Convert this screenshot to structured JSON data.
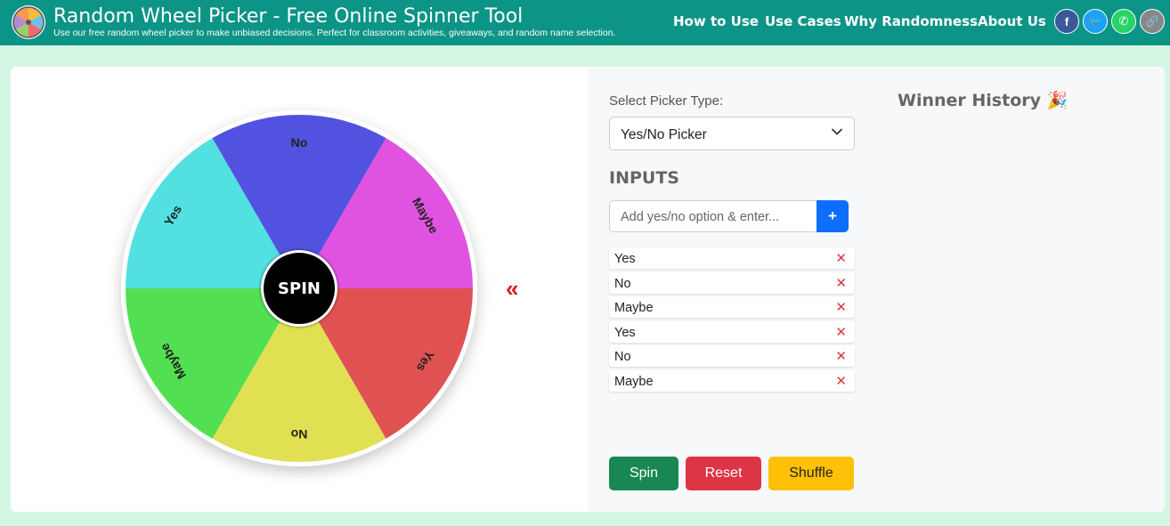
{
  "header": {
    "title": "Random Wheel Picker - Free Online Spinner Tool",
    "subtitle": "Use our free random wheel picker to make unbiased decisions. Perfect for classroom activities, giveaways, and random name selection.",
    "nav": [
      "How to Use",
      "Use Cases",
      "Why Randomness",
      "About Us"
    ],
    "social": [
      {
        "icon": "facebook-icon",
        "glyph": "f",
        "color": "#3b5998"
      },
      {
        "icon": "twitter-icon",
        "glyph": "🐦",
        "color": "#1da1f2"
      },
      {
        "icon": "whatsapp-icon",
        "glyph": "✆",
        "color": "#25d366"
      },
      {
        "icon": "link-icon",
        "glyph": "🔗",
        "color": "#888888"
      }
    ]
  },
  "wheel": {
    "center_label": "SPIN",
    "pointer_glyph": "«",
    "segments": [
      {
        "label": "Maybe",
        "color": "#e052e0"
      },
      {
        "label": "Yes",
        "color": "#e05252"
      },
      {
        "label": "No",
        "color": "#e0e052"
      },
      {
        "label": "Maybe",
        "color": "#52e052"
      },
      {
        "label": "Yes",
        "color": "#52e0e0"
      },
      {
        "label": "No",
        "color": "#5252e0"
      }
    ]
  },
  "controls": {
    "picker_label": "Select Picker Type:",
    "picker_value": "Yes/No Picker",
    "inputs_title": "INPUTS",
    "input_placeholder": "Add yes/no option & enter...",
    "add_label": "+",
    "options": [
      "Yes",
      "No",
      "Maybe",
      "Yes",
      "No",
      "Maybe"
    ],
    "delete_glyph": "✕",
    "spin_label": "Spin",
    "reset_label": "Reset",
    "shuffle_label": "Shuffle"
  },
  "history": {
    "title": "Winner History 🎉"
  }
}
